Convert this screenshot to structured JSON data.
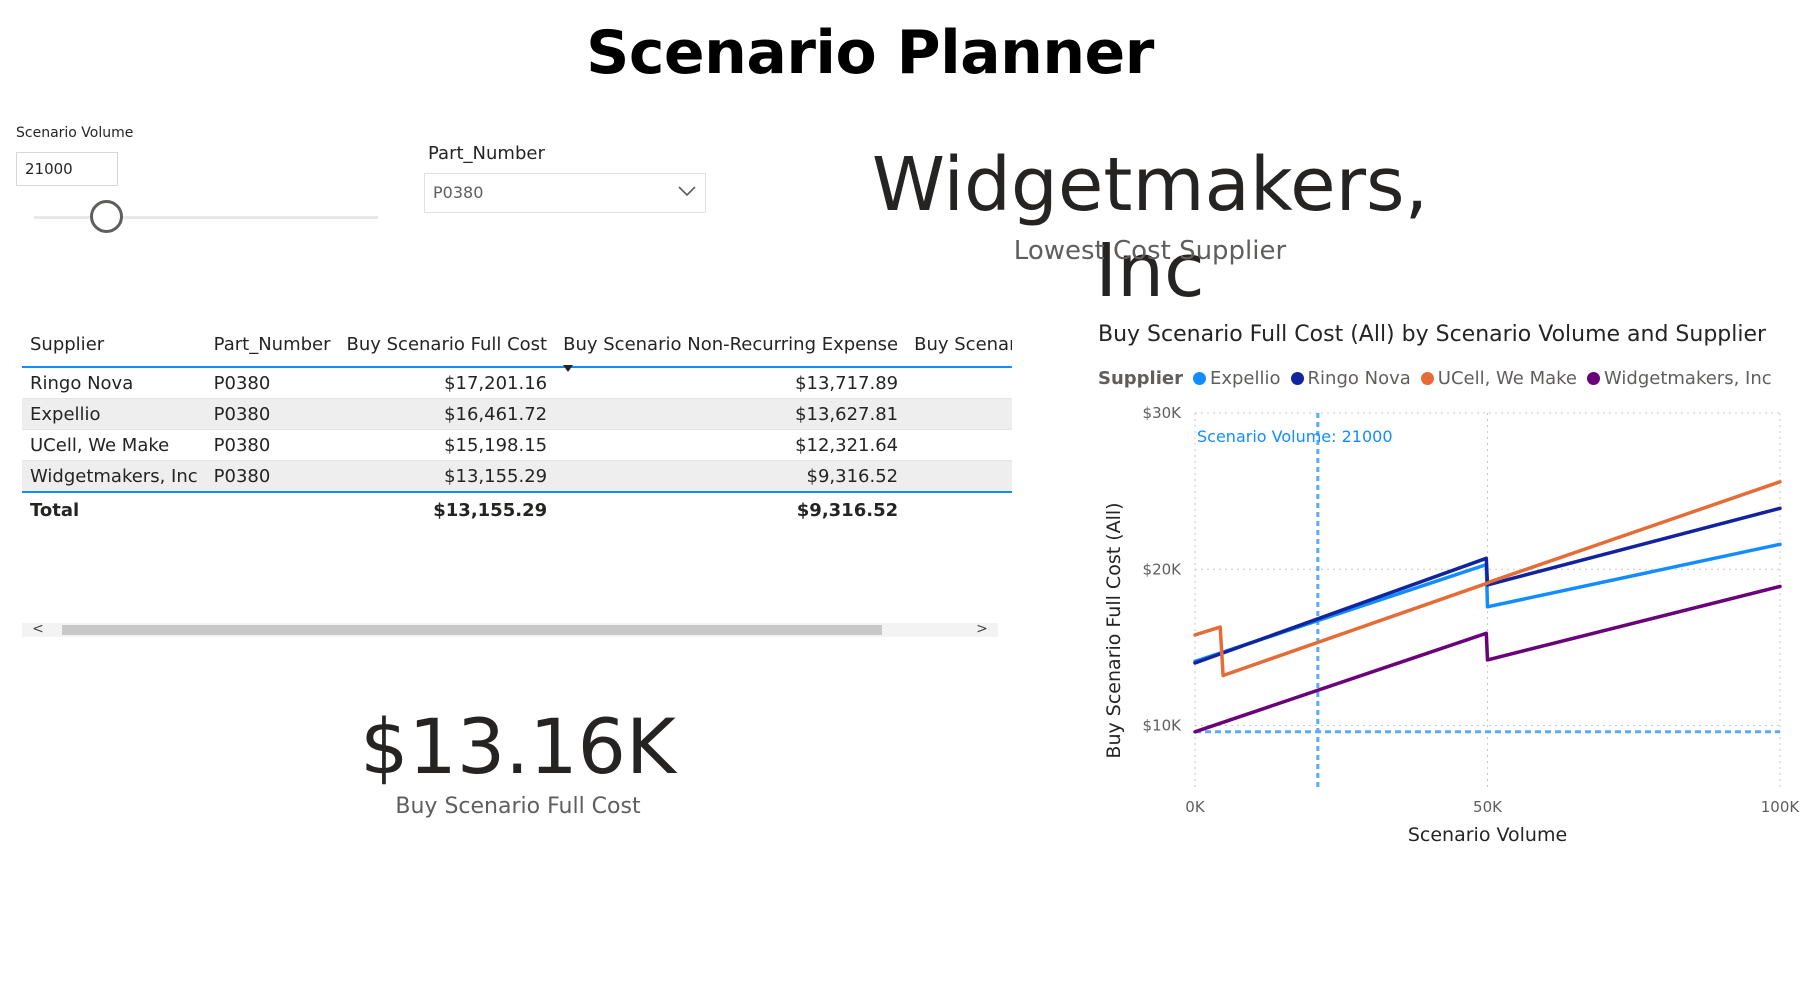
{
  "title": "Scenario Planner",
  "scenario_volume_slicer": {
    "label": "Scenario Volume",
    "value": "21000",
    "slider_fraction": 0.21
  },
  "part_number_slicer": {
    "label": "Part_Number",
    "selected": "P0380"
  },
  "lowest_cost_card": {
    "value": "Widgetmakers, Inc",
    "label": "Lowest Cost Supplier"
  },
  "table": {
    "columns": [
      "Supplier",
      "Part_Number",
      "Buy Scenario Full Cost",
      "Buy Scenario Non-Recurring Expense",
      "Buy Scenario Exter"
    ],
    "rows": [
      {
        "supplier": "Ringo Nova",
        "part": "P0380",
        "full_cost": "$17,201.16",
        "nre": "$13,717.89"
      },
      {
        "supplier": "Expellio",
        "part": "P0380",
        "full_cost": "$16,461.72",
        "nre": "$13,627.81"
      },
      {
        "supplier": "UCell, We Make",
        "part": "P0380",
        "full_cost": "$15,198.15",
        "nre": "$12,321.64"
      },
      {
        "supplier": "Widgetmakers, Inc",
        "part": "P0380",
        "full_cost": "$13,155.29",
        "nre": "$9,316.52"
      }
    ],
    "total": {
      "label": "Total",
      "full_cost": "$13,155.29",
      "nre": "$9,316.52"
    },
    "scroll": {
      "left": "<",
      "right": ">"
    }
  },
  "full_cost_card": {
    "value": "$13.16K",
    "label": "Buy Scenario Full Cost"
  },
  "chart_data": {
    "type": "line",
    "title": "Buy Scenario Full Cost (All) by Scenario Volume and Supplier",
    "legend_title": "Supplier",
    "legend_position": "top-left",
    "xlabel": "Scenario Volume",
    "ylabel": "Buy Scenario Full Cost (All)",
    "xlim": [
      0,
      100000
    ],
    "ylim": [
      6000,
      30000
    ],
    "x_ticks": [
      {
        "v": 0,
        "label": "0K"
      },
      {
        "v": 50000,
        "label": "50K"
      },
      {
        "v": 100000,
        "label": "100K"
      }
    ],
    "y_ticks": [
      {
        "v": 10000,
        "label": "$10K"
      },
      {
        "v": 20000,
        "label": "$20K"
      },
      {
        "v": 30000,
        "label": "$30K"
      }
    ],
    "grid": true,
    "reference_lines": {
      "x": {
        "value": 21000,
        "label": "Scenario Volume: 21000"
      },
      "y": {
        "value": 9600
      }
    },
    "series": [
      {
        "name": "Expellio",
        "color": "#118dff",
        "points": [
          [
            0,
            14100
          ],
          [
            49800,
            20300
          ],
          [
            50000,
            17600
          ],
          [
            100000,
            21600
          ]
        ]
      },
      {
        "name": "Ringo Nova",
        "color": "#12239e",
        "points": [
          [
            0,
            14000
          ],
          [
            49800,
            20700
          ],
          [
            50000,
            19000
          ],
          [
            100000,
            23900
          ]
        ]
      },
      {
        "name": "UCell, We Make",
        "color": "#e66c37",
        "points": [
          [
            0,
            15800
          ],
          [
            4300,
            16300
          ],
          [
            4800,
            13200
          ],
          [
            49900,
            19100
          ],
          [
            50500,
            19200
          ],
          [
            100000,
            25600
          ]
        ]
      },
      {
        "name": "Widgetmakers, Inc",
        "color": "#6b007b",
        "points": [
          [
            0,
            9600
          ],
          [
            49800,
            15900
          ],
          [
            50000,
            14200
          ],
          [
            100000,
            18900
          ]
        ]
      }
    ]
  }
}
